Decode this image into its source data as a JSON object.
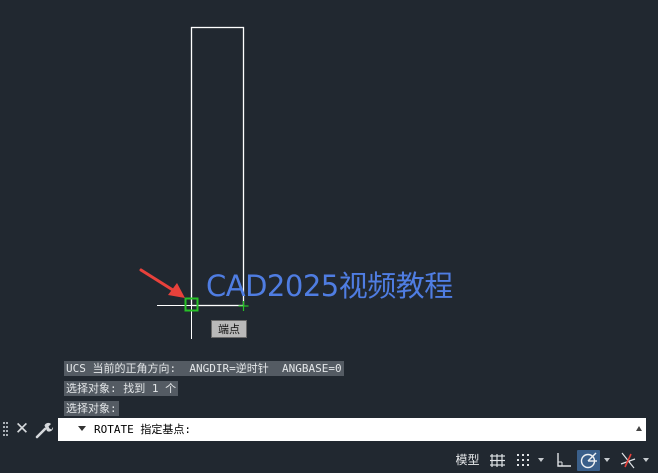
{
  "watermark": "CAD2025视频教程",
  "snap_tooltip": "端点",
  "command_history": [
    "UCS 当前的正角方向:  ANGDIR=逆时针  ANGBASE=0",
    "选择对象: 找到 1 个",
    "选择对象:"
  ],
  "command_line": {
    "prompt": "ROTATE 指定基点:"
  },
  "status_bar": {
    "model_label": "模型"
  },
  "icons": {
    "close": "close-icon",
    "customize": "wrench-icon",
    "grid": "grid-icon",
    "snap": "snap-dots-icon",
    "ortho": "ortho-icon",
    "polar": "polar-tracking-icon",
    "isodraft": "isometric-icon"
  },
  "colors": {
    "background": "#212830",
    "geometry": "#ffffff",
    "snap_marker": "#27c227",
    "watermark": "#4f7de2",
    "arrow": "#e8413b",
    "active_toggle": "#3a5f8a"
  }
}
